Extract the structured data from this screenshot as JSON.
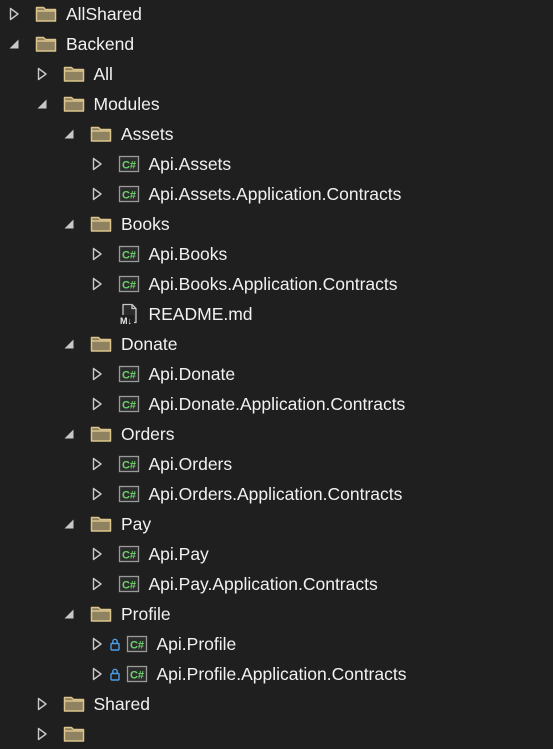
{
  "tree": [
    {
      "label": "AllShared",
      "type": "folder",
      "depth": 0,
      "expanded": false
    },
    {
      "label": "Backend",
      "type": "folder",
      "depth": 0,
      "expanded": true
    },
    {
      "label": "All",
      "type": "folder",
      "depth": 1,
      "expanded": false
    },
    {
      "label": "Modules",
      "type": "folder",
      "depth": 1,
      "expanded": true
    },
    {
      "label": "Assets",
      "type": "folder",
      "depth": 2,
      "expanded": true
    },
    {
      "label": "Api.Assets",
      "type": "csproj",
      "depth": 3,
      "expanded": false
    },
    {
      "label": "Api.Assets.Application.Contracts",
      "type": "csproj",
      "depth": 3,
      "expanded": false
    },
    {
      "label": "Books",
      "type": "folder",
      "depth": 2,
      "expanded": true
    },
    {
      "label": "Api.Books",
      "type": "csproj",
      "depth": 3,
      "expanded": false
    },
    {
      "label": "Api.Books.Application.Contracts",
      "type": "csproj",
      "depth": 3,
      "expanded": false
    },
    {
      "label": "README.md",
      "type": "markdown",
      "depth": 3,
      "expanded": null
    },
    {
      "label": "Donate",
      "type": "folder",
      "depth": 2,
      "expanded": true
    },
    {
      "label": "Api.Donate",
      "type": "csproj",
      "depth": 3,
      "expanded": false
    },
    {
      "label": "Api.Donate.Application.Contracts",
      "type": "csproj",
      "depth": 3,
      "expanded": false
    },
    {
      "label": "Orders",
      "type": "folder",
      "depth": 2,
      "expanded": true
    },
    {
      "label": "Api.Orders",
      "type": "csproj",
      "depth": 3,
      "expanded": false
    },
    {
      "label": "Api.Orders.Application.Contracts",
      "type": "csproj",
      "depth": 3,
      "expanded": false
    },
    {
      "label": "Pay",
      "type": "folder",
      "depth": 2,
      "expanded": true
    },
    {
      "label": "Api.Pay",
      "type": "csproj",
      "depth": 3,
      "expanded": false
    },
    {
      "label": "Api.Pay.Application.Contracts",
      "type": "csproj",
      "depth": 3,
      "expanded": false
    },
    {
      "label": "Profile",
      "type": "folder",
      "depth": 2,
      "expanded": true
    },
    {
      "label": "Api.Profile",
      "type": "csproj",
      "depth": 3,
      "expanded": false,
      "locked": true
    },
    {
      "label": "Api.Profile.Application.Contracts",
      "type": "csproj",
      "depth": 3,
      "expanded": false,
      "locked": true
    },
    {
      "label": "Shared",
      "type": "folder",
      "depth": 1,
      "expanded": false
    },
    {
      "label": "",
      "type": "folder",
      "depth": 1,
      "expanded": false
    }
  ],
  "colors": {
    "background": "#1f1f1f",
    "text": "#f1f1f1",
    "folder_fill": "#8f8260",
    "folder_stroke": "#dcc48c",
    "csharp_green": "#6fd46f",
    "lock_blue": "#4a9ee8",
    "arrow": "#c8c8c8"
  }
}
